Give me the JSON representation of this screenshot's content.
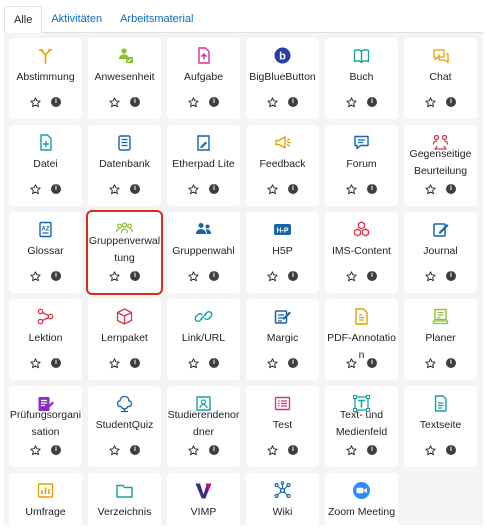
{
  "tabs": [
    {
      "label": "Alle",
      "active": true
    },
    {
      "label": "Aktivitäten",
      "active": false
    },
    {
      "label": "Arbeitsmaterial",
      "active": false
    }
  ],
  "info_glyph": "i",
  "tiles": [
    {
      "label": "Abstimmung",
      "icon": "choice-icon",
      "color": "#e5a100"
    },
    {
      "label": "Anwesenheit",
      "icon": "attendance-icon",
      "color": "#8ac326"
    },
    {
      "label": "Aufgabe",
      "icon": "assignment-icon",
      "color": "#d0368b"
    },
    {
      "label": "BigBlueButton",
      "icon": "bigbluebutton-icon",
      "color": "#283ea7"
    },
    {
      "label": "Buch",
      "icon": "book-icon",
      "color": "#16a0a0"
    },
    {
      "label": "Chat",
      "icon": "chat-icon",
      "color": "#e5a100"
    },
    {
      "label": "Datei",
      "icon": "file-icon",
      "color": "#16a0a0"
    },
    {
      "label": "Datenbank",
      "icon": "database-icon",
      "color": "#1864a8"
    },
    {
      "label": "Etherpad Lite",
      "icon": "etherpad-icon",
      "color": "#1864a8"
    },
    {
      "label": "Feedback",
      "icon": "feedback-icon",
      "color": "#e5a100"
    },
    {
      "label": "Forum",
      "icon": "forum-icon",
      "color": "#1864a8"
    },
    {
      "label": "Gegenseitige Beurteilung",
      "icon": "workshop-icon",
      "color": "#d6374f"
    },
    {
      "label": "Glossar",
      "icon": "glossary-icon",
      "color": "#1864a8"
    },
    {
      "label": "Gruppenverwaltung",
      "icon": "group-management-icon",
      "color": "#8ac326",
      "highlighted": true
    },
    {
      "label": "Gruppenwahl",
      "icon": "group-choice-icon",
      "color": "#1864a8"
    },
    {
      "label": "H5P",
      "icon": "h5p-icon",
      "color": "#1864a8"
    },
    {
      "label": "IMS-Content",
      "icon": "ims-content-icon",
      "color": "#d6374f"
    },
    {
      "label": "Journal",
      "icon": "journal-icon",
      "color": "#1864a8"
    },
    {
      "label": "Lektion",
      "icon": "lesson-icon",
      "color": "#d6374f"
    },
    {
      "label": "Lernpaket",
      "icon": "scorm-package-icon",
      "color": "#d6374f"
    },
    {
      "label": "Link/URL",
      "icon": "url-link-icon",
      "color": "#16a0a0"
    },
    {
      "label": "Margic",
      "icon": "margic-icon",
      "color": "#1864a8"
    },
    {
      "label": "PDF-Annotation",
      "icon": "pdf-annotation-icon",
      "color": "#e5a100"
    },
    {
      "label": "Planer",
      "icon": "planner-icon",
      "color": "#8ac326"
    },
    {
      "label": "Prüfungsorganisation",
      "icon": "exam-organisation-icon",
      "color": "#8c2bcc"
    },
    {
      "label": "StudentQuiz",
      "icon": "studentquiz-icon",
      "color": "#1864a8"
    },
    {
      "label": "Studierendenordner",
      "icon": "student-folder-icon",
      "color": "#16a0a0"
    },
    {
      "label": "Test",
      "icon": "quiz-icon",
      "color": "#d0368b"
    },
    {
      "label": "Text- und Medienfeld",
      "icon": "text-media-icon",
      "color": "#16a0a0"
    },
    {
      "label": "Textseite",
      "icon": "page-icon",
      "color": "#16a0a0"
    },
    {
      "label": "Umfrage",
      "icon": "survey-icon",
      "color": "#e5a100"
    },
    {
      "label": "Verzeichnis",
      "icon": "folder-icon",
      "color": "#16a0a0"
    },
    {
      "label": "VIMP",
      "icon": "vimp-icon",
      "color": "#3c2a7f"
    },
    {
      "label": "Wiki",
      "icon": "wiki-icon",
      "color": "#1864a8"
    },
    {
      "label": "Zoom Meeting",
      "icon": "zoom-icon",
      "color": "#2d8cff"
    }
  ]
}
